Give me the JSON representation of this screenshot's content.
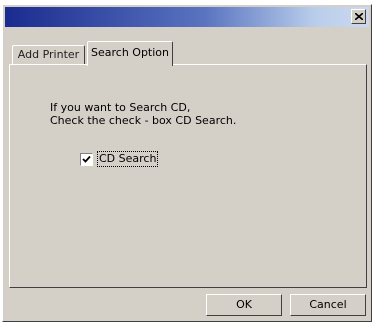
{
  "window": {
    "title": "",
    "close_icon": "close-icon"
  },
  "tabs": [
    {
      "label": "Add Printer",
      "active": false
    },
    {
      "label": "Search Option",
      "active": true
    }
  ],
  "search_option": {
    "instruction_line1": "If  you want to Search CD,",
    "instruction_line2": "Check the check - box CD Search.",
    "cd_search": {
      "label": "CD Search",
      "checked": true
    }
  },
  "buttons": {
    "ok": "OK",
    "cancel": "Cancel"
  },
  "colors": {
    "face": "#d4d0c8",
    "title_dark": "#1a2b8e",
    "title_light": "#cdd9ef"
  }
}
